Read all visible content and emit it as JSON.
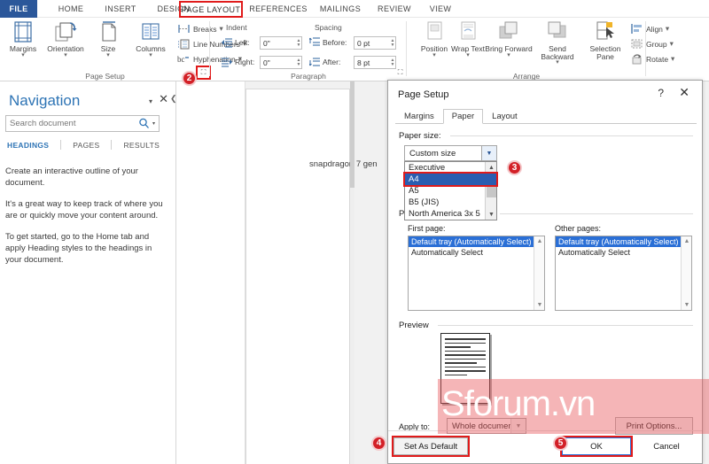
{
  "ribbon": {
    "tabs": [
      {
        "label": "FILE",
        "selected": false
      },
      {
        "label": "HOME",
        "selected": false
      },
      {
        "label": "INSERT",
        "selected": false
      },
      {
        "label": "DESIGN",
        "selected": false
      },
      {
        "label": "PAGE LAYOUT",
        "selected": true
      },
      {
        "label": "REFERENCES",
        "selected": false
      },
      {
        "label": "MAILINGS",
        "selected": false
      },
      {
        "label": "REVIEW",
        "selected": false
      },
      {
        "label": "VIEW",
        "selected": false
      }
    ],
    "groups": {
      "page_setup": {
        "label": "Page Setup",
        "buttons": [
          {
            "label": "Margins",
            "icon": "margins-icon"
          },
          {
            "label": "Orientation",
            "icon": "orientation-icon"
          },
          {
            "label": "Size",
            "icon": "size-icon"
          },
          {
            "label": "Columns",
            "icon": "columns-icon"
          }
        ],
        "small_buttons": [
          {
            "label": "Breaks",
            "icon": "breaks-icon"
          },
          {
            "label": "Line Numbers",
            "icon": "line-numbers-icon"
          },
          {
            "label": "Hyphenation",
            "icon": "hyphenation-icon"
          }
        ]
      },
      "paragraph": {
        "label": "Paragraph",
        "indent_header": "Indent",
        "spacing_header": "Spacing",
        "fields": [
          {
            "label": "Left:",
            "value": "0\"",
            "icon": "indent-left-icon"
          },
          {
            "label": "Right:",
            "value": "0\"",
            "icon": "indent-right-icon"
          },
          {
            "label": "Before:",
            "value": "0 pt",
            "icon": "spacing-before-icon"
          },
          {
            "label": "After:",
            "value": "8 pt",
            "icon": "spacing-after-icon"
          }
        ]
      },
      "arrange": {
        "label": "Arrange",
        "buttons": [
          {
            "label": "Position",
            "icon": "position-icon"
          },
          {
            "label": "Wrap Text",
            "icon": "wrap-text-icon"
          },
          {
            "label": "Bring Forward",
            "icon": "bring-forward-icon"
          },
          {
            "label": "Send Backward",
            "icon": "send-backward-icon"
          },
          {
            "label": "Selection Pane",
            "icon": "selection-pane-icon"
          }
        ],
        "small_buttons": [
          {
            "label": "Align",
            "icon": "align-icon"
          },
          {
            "label": "Group",
            "icon": "group-icon"
          },
          {
            "label": "Rotate",
            "icon": "rotate-icon"
          }
        ]
      }
    }
  },
  "navigation": {
    "title": "Navigation",
    "search_placeholder": "Search document",
    "search_value": "",
    "tabs": [
      {
        "label": "HEADINGS",
        "active": true
      },
      {
        "label": "PAGES",
        "active": false
      },
      {
        "label": "RESULTS",
        "active": false
      }
    ],
    "paragraphs": [
      "Create an interactive outline of your document.",
      "It's a great way to keep track of where you are or quickly move your content around.",
      "To get started, go to the Home tab and apply Heading styles to the headings in your document."
    ]
  },
  "document": {
    "body_text": "snapdragon 7 gen"
  },
  "dialog": {
    "title": "Page Setup",
    "help_glyph": "?",
    "close_glyph": "✕",
    "tabs": [
      {
        "label": "Margins",
        "active": false
      },
      {
        "label": "Paper",
        "active": true
      },
      {
        "label": "Layout",
        "active": false
      }
    ],
    "paper_size": {
      "label": "Paper size:",
      "selected": "Custom size",
      "options": [
        {
          "label": "Executive",
          "selected": false
        },
        {
          "label": "A4",
          "selected": true
        },
        {
          "label": "A5",
          "selected": false
        },
        {
          "label": "B5 (JIS)",
          "selected": false
        },
        {
          "label": "North America 3x 5",
          "selected": false
        }
      ]
    },
    "paper_source": {
      "label": "Paper source",
      "first_page_label": "First page:",
      "other_pages_label": "Other pages:",
      "first_page_items": [
        {
          "label": "Default tray (Automatically Select)",
          "selected": true
        },
        {
          "label": "Automatically Select",
          "selected": false
        }
      ],
      "other_pages_items": [
        {
          "label": "Default tray (Automatically Select)",
          "selected": true
        },
        {
          "label": "Automatically Select",
          "selected": false
        }
      ]
    },
    "preview": {
      "label": "Preview",
      "apply_to_label": "Apply to:",
      "apply_to_value": "Whole document",
      "print_options_label": "Print Options..."
    },
    "footer": {
      "set_as_default": "Set As Default",
      "ok": "OK",
      "cancel": "Cancel"
    }
  },
  "annotations": {
    "steps": [
      {
        "number": "2"
      },
      {
        "number": "3"
      },
      {
        "number": "4"
      },
      {
        "number": "5"
      }
    ],
    "highlight_color": "#e01b1b",
    "badge_color": "#d32027"
  },
  "watermark": {
    "text": "forum.vn",
    "logo": "S",
    "color": "#e85c5f"
  }
}
